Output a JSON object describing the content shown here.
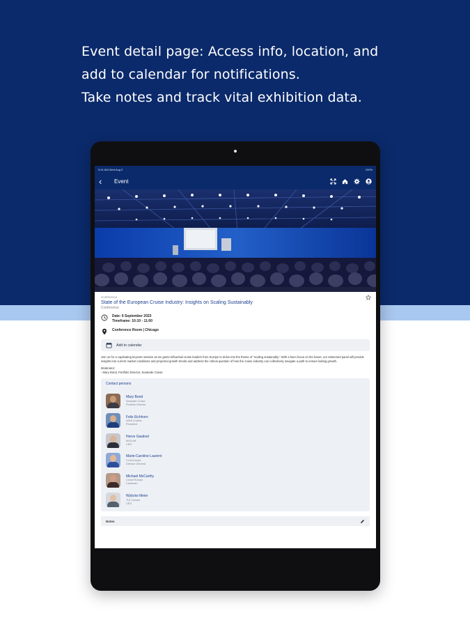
{
  "headline": {
    "line1": "Event detail page: Access info, location, and",
    "line2": "add to calendar for notifications.",
    "line3": "Take notes and track vital exhibition data."
  },
  "status_bar": {
    "time": "9:41 AM  Wed Aug 3",
    "battery": "100%"
  },
  "app_bar": {
    "back_icon": "chevron-left-icon",
    "title": "Event",
    "actions": [
      "expand-icon",
      "home-icon",
      "settings-icon",
      "user-icon"
    ]
  },
  "event": {
    "category": "Conference",
    "title": "State of the European Cruise Industry: Insights on Scaling Sustainably",
    "type": "Conference",
    "date_label": "Date: 6 September 2023",
    "timeframe_label": "Timeframe: 10:10 - 11:00",
    "location": "Conference Room | Chicago",
    "add_to_calendar": "Add to calendar",
    "description": "Join us for a captivating keynote session as six game-influential cruise leaders from Europe to delve into the theme of \"scaling sustainably.\" With a keen focus on the future, our esteemed panel will provide insights into current market conditions and projected growth trends and address the critical question of how the cruise industry can collectively navigate a path to ensure lasting growth.",
    "moderator_label": "Moderator:",
    "moderator_name": "- Mary Bond, Portfolio Director, Seatrade Cruise"
  },
  "contacts": {
    "title": "Contact persons",
    "people": [
      {
        "name": "Mary Bond",
        "company": "Seatrade Cruise",
        "role": "Portfolio Director",
        "skin": "#c89a7a",
        "shirt": "#3b3b44",
        "bg": "#8c6b52"
      },
      {
        "name": "Felix Eichhorn",
        "company": "AIDA Cruises",
        "role": "President",
        "skin": "#d8ae90",
        "shirt": "#1e3d7a",
        "bg": "#6f8fb8"
      },
      {
        "name": "Herve Gastinel",
        "company": "MSCruff",
        "role": "CEO",
        "skin": "#d9b49a",
        "shirt": "#2b2f3a",
        "bg": "#c8c8cc"
      },
      {
        "name": "Marie-Caroline Laurent",
        "company": "CLIA Europe",
        "role": "Director General",
        "skin": "#e1b996",
        "shirt": "#2d4f9a",
        "bg": "#8fa9d6"
      },
      {
        "name": "Michael McCarthy",
        "company": "Cruise Europe",
        "role": "Chairman",
        "skin": "#cf9e84",
        "shirt": "#3b2a2a",
        "bg": "#b59a88"
      },
      {
        "name": "Wybcke Meier",
        "company": "TUI Cruises",
        "role": "CEO",
        "skin": "#e0c0a6",
        "shirt": "#55606e",
        "bg": "#d7d9df"
      }
    ]
  },
  "notes_label": "Notes",
  "colors": {
    "brand_navy": "#0b2a6b",
    "stripe": "#a9c8ef",
    "link_blue": "#1b3f8f"
  }
}
